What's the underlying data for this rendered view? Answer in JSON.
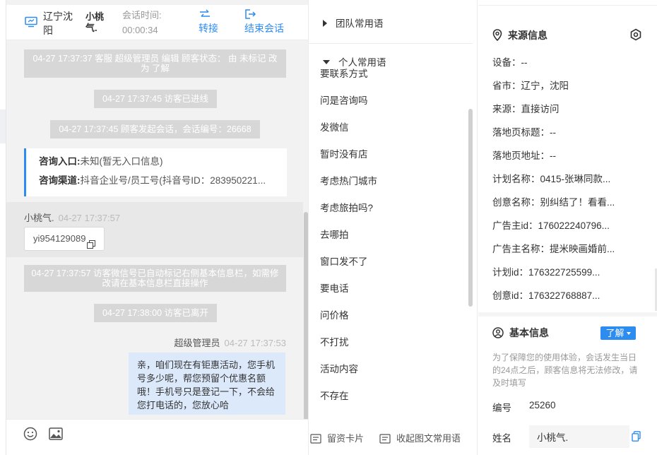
{
  "header": {
    "location": "辽宁沈阳",
    "visitor_name": "小桃气.",
    "time_label": "会话时间:",
    "time_value": "00:00:34",
    "transfer_label": "转接",
    "end_label": "结束会话"
  },
  "chat": {
    "system_messages": [
      "04-27 17:37:37 客服 超级管理员 编辑 顾客状态： 由 未标记 改为 了解",
      "04-27 17:37:45 访客已进线",
      "04-27 17:37:45 顾客发起会话，会话编号：26668",
      "04-27 17:37:57 访客微信号已自动标记右侧基本信息栏，如需修改请在基本信息栏直接操作",
      "04-27 17:38:00 访客已离开"
    ],
    "entry_card": {
      "entry_label": "咨询入口:",
      "entry_value": "未知(暂无入口信息)",
      "channel_label": "咨询渠道:",
      "channel_value": "抖音企业号/员工号(抖音号ID：283950221..."
    },
    "visitor_message": {
      "name": "小桃气.",
      "time": "04-27 17:37:57",
      "wechat_id": "yi954129089"
    },
    "agent_message": {
      "name": "超级管理员",
      "time": "04-27 17:37:53",
      "text": "亲，咱们现在有钜惠活动，您手机号多少呢，帮您预留个优惠名额哦！手机号只是登记一下，不会给您打电话的，您放心哈"
    }
  },
  "quick_replies": {
    "team_group": "团队常用语",
    "personal_group": "个人常用语",
    "items": [
      "要联系方式",
      "问是咨询吗",
      "发微信",
      "暂时没有店",
      "考虑热门城市",
      "考虑旅拍吗?",
      "去哪拍",
      "窗口发不了",
      "要电话",
      "问价格",
      "不打扰",
      "活动内容",
      "不存在"
    ],
    "footer_card": "留资卡片",
    "footer_fav": "收起图文常用语"
  },
  "source_info": {
    "title": "来源信息",
    "rows": [
      "设备：--",
      "省市：辽宁，沈阳",
      "来源：直接访问",
      "落地页标题：--",
      "落地页地址：--",
      "计划名称：0415-张琳同款...",
      "创意名称：别纠结了！看看...",
      "广告主id：176022240796...",
      "广告主名称：提米映画婚前...",
      "计划id：176322725599...",
      "创意id：176322768887..."
    ]
  },
  "basic_info": {
    "title": "基本信息",
    "status_button": "了解",
    "hint": "为了保障您的使用体验，会话发生当日的24点之后，顾客信息将无法修改，请及时填写",
    "number_label": "编号",
    "number_value": "25260",
    "name_label": "姓名",
    "name_value": "小桃气."
  },
  "colors": {
    "accent": "#2d8cf0",
    "system_bubble": "#d7d7d7",
    "agent_bubble": "#dbe9fb"
  }
}
